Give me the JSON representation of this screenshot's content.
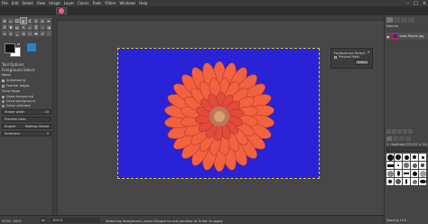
{
  "menubar": {
    "items": [
      "File",
      "Edit",
      "Select",
      "View",
      "Image",
      "Layer",
      "Colors",
      "Tools",
      "Filters",
      "Windows",
      "Help"
    ]
  },
  "window_controls": [
    "minimize-icon",
    "maximize-icon",
    "close-icon"
  ],
  "tool_options": {
    "panel_title": "Tool Options",
    "tool_title": "Foreground Select",
    "mode_label": "Mode",
    "antialias_label": "Antialiasing",
    "feather_label": "Feather edges",
    "draw_mode_label": "Draw Mode",
    "draw_modes": [
      "Draw foreground",
      "Draw background",
      "Draw unknown"
    ],
    "draw_mode_selected": 0,
    "stroke_width_label": "Stroke width",
    "stroke_width_value": "10",
    "preview_color_label": "Preview color",
    "engine_label": "Engine",
    "engine_value": "Matting Global",
    "iterations_label": "Iterations",
    "iterations_value": "2"
  },
  "colors": {
    "foreground": "#111111",
    "background": "#ffffff",
    "accent": "#2d7fcf"
  },
  "image_tab": {
    "thumb_color": "#ff5a86"
  },
  "canvas": {
    "image_bg": "#2a22d6",
    "flower_outer": "#f2623f",
    "flower_inner": "#e24a3a",
    "flower_center": "#b87a5a"
  },
  "fs_popup": {
    "title": "Foreground Select",
    "preview_mask_label": "Preview Mask",
    "select_button": "Select"
  },
  "statusbar": {
    "coords": "4576, 1812",
    "unit": "px",
    "zoom": "100 %",
    "message": "Selecting foreground, press Escape to exit preview or Enter to apply."
  },
  "layers": {
    "mode": "Normal",
    "layer_name": "Iowa Maybe.jpg"
  },
  "brushes": {
    "header": "2. Hardness 050 (51 × 51)",
    "spacing_label": "Spacing",
    "spacing_value": "10.0"
  }
}
